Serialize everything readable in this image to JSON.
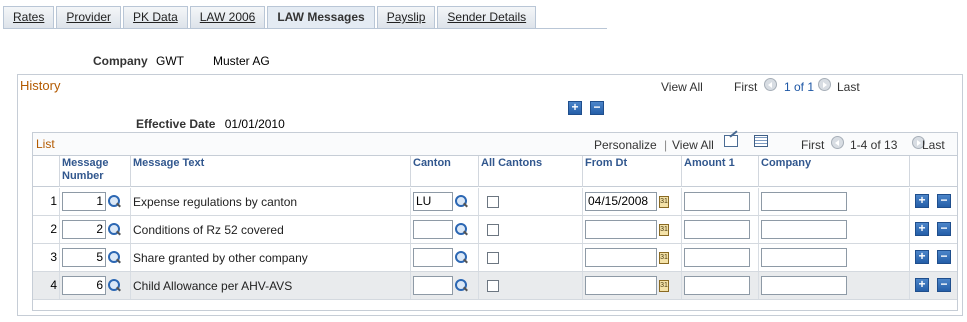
{
  "tabs": [
    {
      "label": "Rates",
      "active": false
    },
    {
      "label": "Provider",
      "active": false
    },
    {
      "label": "PK Data",
      "active": false
    },
    {
      "label": "LAW 2006",
      "active": false
    },
    {
      "label": "LAW Messages",
      "active": true
    },
    {
      "label": "Payslip",
      "active": false
    },
    {
      "label": "Sender Details",
      "active": false
    }
  ],
  "company": {
    "label": "Company",
    "code": "GWT",
    "name": "Muster AG"
  },
  "history": {
    "title": "History",
    "view_all": "View All",
    "first": "First",
    "range": "1 of 1",
    "last": "Last",
    "add_label": "+",
    "remove_label": "−",
    "effective_label": "Effective Date",
    "effective_value": "01/01/2010"
  },
  "list": {
    "title": "List",
    "personalize": "Personalize",
    "separator": "|",
    "view_all": "View All",
    "first": "First",
    "range": "1-4 of 13",
    "last": "Last",
    "headers": {
      "message_number_1": "Message",
      "message_number_2": "Number",
      "message_text": "Message Text",
      "canton": "Canton",
      "all_cantons": "All Cantons",
      "from_dt": "From Dt",
      "amount1": "Amount 1",
      "company": "Company"
    },
    "rows": [
      {
        "num": "1",
        "message_number": "1",
        "message_text": "Expense regulations by canton",
        "canton": "LU",
        "from_dt": "04/15/2008",
        "amount1": "",
        "company": ""
      },
      {
        "num": "2",
        "message_number": "2",
        "message_text": "Conditions of Rz 52 covered",
        "canton": "",
        "from_dt": "",
        "amount1": "",
        "company": ""
      },
      {
        "num": "3",
        "message_number": "5",
        "message_text": "Share granted by other company",
        "canton": "",
        "from_dt": "",
        "amount1": "",
        "company": ""
      },
      {
        "num": "4",
        "message_number": "6",
        "message_text": "Child Allowance per AHV-AVS",
        "canton": "",
        "from_dt": "",
        "amount1": "",
        "company": ""
      }
    ],
    "add_label": "+",
    "remove_label": "−",
    "cal_label": "31"
  }
}
